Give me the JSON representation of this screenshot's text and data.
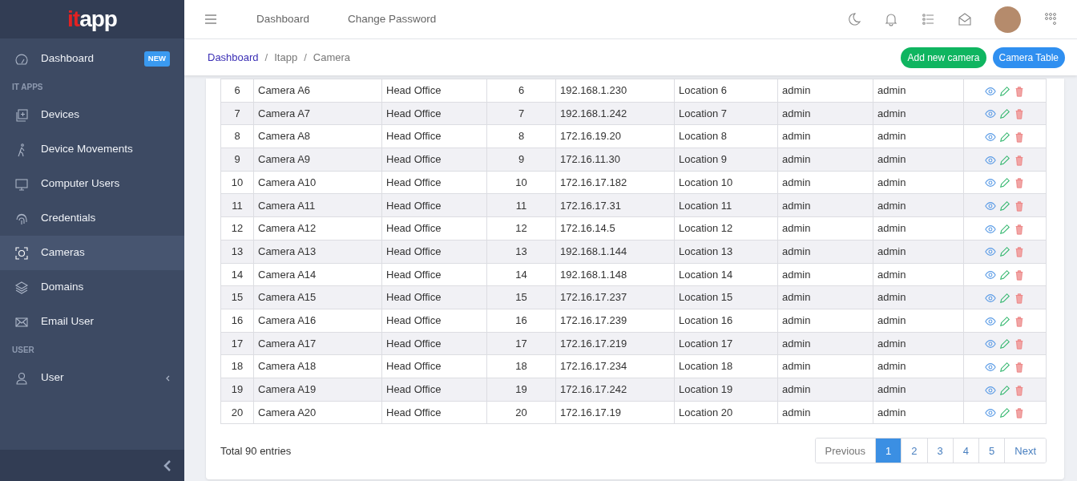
{
  "logo": {
    "accent": "it",
    "rest": "app"
  },
  "sidebar": {
    "items": [
      {
        "kind": "link",
        "label": "Dashboard",
        "badge": "NEW",
        "selected": false
      },
      {
        "kind": "section",
        "label": "IT APPS"
      },
      {
        "kind": "link",
        "label": "Devices",
        "selected": false
      },
      {
        "kind": "link",
        "label": "Device Movements",
        "selected": false
      },
      {
        "kind": "link",
        "label": "Computer Users",
        "selected": false
      },
      {
        "kind": "link",
        "label": "Credentials",
        "selected": false
      },
      {
        "kind": "link",
        "label": "Cameras",
        "selected": true
      },
      {
        "kind": "link",
        "label": "Domains",
        "selected": false
      },
      {
        "kind": "link",
        "label": "Email User",
        "selected": false
      },
      {
        "kind": "section",
        "label": "USER"
      },
      {
        "kind": "group",
        "label": "User",
        "selected": false
      }
    ]
  },
  "topbar": {
    "links": [
      "Dashboard",
      "Change Password"
    ]
  },
  "breadcrumb": [
    {
      "kind": "link",
      "label": "Dashboard"
    },
    {
      "kind": "separator",
      "label": "/"
    },
    {
      "kind": "text",
      "label": "Itapp"
    },
    {
      "kind": "separator",
      "label": "/"
    },
    {
      "kind": "text",
      "label": "Camera"
    }
  ],
  "actions": [
    {
      "label": "Add new camera",
      "kind": "success"
    },
    {
      "label": "Camera Table",
      "kind": "primary"
    }
  ],
  "table": {
    "rows": [
      [
        "6",
        "Camera A6",
        "Head Office",
        "6",
        "192.168.1.230",
        "Location 6",
        "admin",
        "admin"
      ],
      [
        "7",
        "Camera A7",
        "Head Office",
        "7",
        "192.168.1.242",
        "Location 7",
        "admin",
        "admin"
      ],
      [
        "8",
        "Camera A8",
        "Head Office",
        "8",
        "172.16.19.20",
        "Location 8",
        "admin",
        "admin"
      ],
      [
        "9",
        "Camera A9",
        "Head Office",
        "9",
        "172.16.11.30",
        "Location 9",
        "admin",
        "admin"
      ],
      [
        "10",
        "Camera A10",
        "Head Office",
        "10",
        "172.16.17.182",
        "Location 10",
        "admin",
        "admin"
      ],
      [
        "11",
        "Camera A11",
        "Head Office",
        "11",
        "172.16.17.31",
        "Location 11",
        "admin",
        "admin"
      ],
      [
        "12",
        "Camera A12",
        "Head Office",
        "12",
        "172.16.14.5",
        "Location 12",
        "admin",
        "admin"
      ],
      [
        "13",
        "Camera A13",
        "Head Office",
        "13",
        "192.168.1.144",
        "Location 13",
        "admin",
        "admin"
      ],
      [
        "14",
        "Camera A14",
        "Head Office",
        "14",
        "192.168.1.148",
        "Location 14",
        "admin",
        "admin"
      ],
      [
        "15",
        "Camera A15",
        "Head Office",
        "15",
        "172.16.17.237",
        "Location 15",
        "admin",
        "admin"
      ],
      [
        "16",
        "Camera A16",
        "Head Office",
        "16",
        "172.16.17.239",
        "Location 16",
        "admin",
        "admin"
      ],
      [
        "17",
        "Camera A17",
        "Head Office",
        "17",
        "172.16.17.219",
        "Location 17",
        "admin",
        "admin"
      ],
      [
        "18",
        "Camera A18",
        "Head Office",
        "18",
        "172.16.17.234",
        "Location 18",
        "admin",
        "admin"
      ],
      [
        "19",
        "Camera A19",
        "Head Office",
        "19",
        "172.16.17.242",
        "Location 19",
        "admin",
        "admin"
      ],
      [
        "20",
        "Camera A20",
        "Head Office",
        "20",
        "172.16.17.19",
        "Location 20",
        "admin",
        "admin"
      ]
    ]
  },
  "total": "Total 90 entries",
  "pagination": [
    {
      "label": "Previous",
      "selected": false
    },
    {
      "label": "1",
      "selected": true
    },
    {
      "label": "2",
      "selected": false
    },
    {
      "label": "3",
      "selected": false
    },
    {
      "label": "4",
      "selected": false
    },
    {
      "label": "5",
      "selected": false
    },
    {
      "label": "Next",
      "selected": false
    }
  ]
}
